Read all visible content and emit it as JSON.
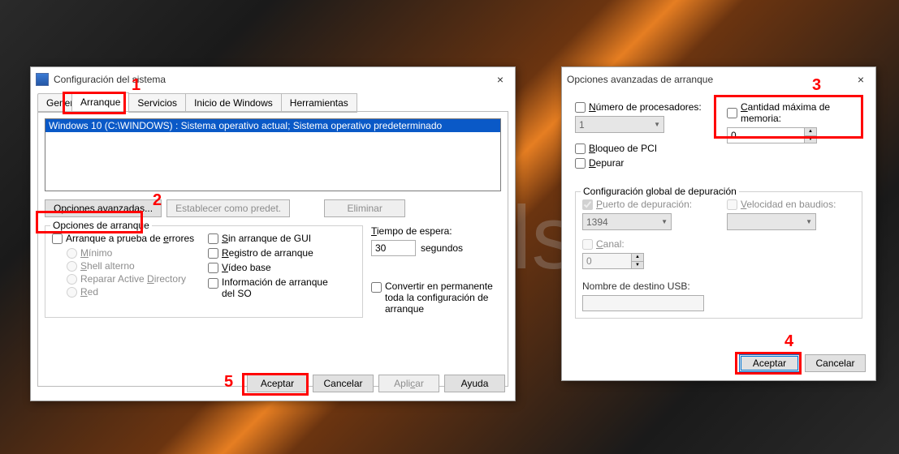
{
  "bg_text": "lso",
  "annotations": {
    "n1": "1",
    "n2": "2",
    "n3": "3",
    "n4": "4",
    "n5": "5"
  },
  "win1": {
    "title": "Configuración del sistema",
    "close": "×",
    "tabs": {
      "general": "General",
      "boot": "Arranque",
      "services": "Servicios",
      "startup": "Inicio de Windows",
      "tools": "Herramientas"
    },
    "boot_entry": "Windows 10 (C:\\WINDOWS) : Sistema operativo actual; Sistema operativo predeterminado",
    "buttons": {
      "advanced": "Opciones avanzadas...",
      "set_default": "Establecer como predet.",
      "delete": "Eliminar"
    },
    "group_boot": {
      "title": "Opciones de arranque",
      "safe": "Arranque a prueba de errores",
      "safe_u": "e",
      "min": "Mínimo",
      "min_u": "M",
      "altshell": "Shell alterno",
      "altshell_u": "S",
      "adrepair": "Reparar Active Directory",
      "adrepair_u": "D",
      "net": "Red",
      "net_u": "R",
      "nogui": "Sin arranque de GUI",
      "nogui_u": "S",
      "bootlog": "Registro de arranque",
      "bootlog_u": "R",
      "basevid": "Vídeo base",
      "basevid_u": "V",
      "osinfo": "Información de arranque del SO"
    },
    "timeout": {
      "label": "Tiempo de espera:",
      "label_u": "T",
      "value": "30",
      "unit": "segundos"
    },
    "permanent": "Convertir en permanente toda la configuración de arranque",
    "footer": {
      "ok": "Aceptar",
      "cancel": "Cancelar",
      "apply": "Aplicar",
      "help": "Ayuda"
    }
  },
  "win2": {
    "title": "Opciones avanzadas de arranque",
    "close": "×",
    "nproc": {
      "label": "Número de procesadores:",
      "label_u": "N",
      "value": "1"
    },
    "maxmem": {
      "label": "Cantidad máxima de memoria:",
      "label_u": "C",
      "value": "0"
    },
    "pcilock": {
      "label": "Bloqueo de PCI",
      "label_u": "B"
    },
    "debug": {
      "label": "Depurar",
      "label_u": "D"
    },
    "group_debug": {
      "title": "Configuración global de depuración",
      "port": {
        "label": "Puerto de depuración:",
        "label_u": "P",
        "value": "1394"
      },
      "baud": {
        "label": "Velocidad en baudios:",
        "label_u": "V",
        "value": ""
      },
      "channel": {
        "label": "Canal:",
        "label_u": "C",
        "value": "0"
      },
      "usb": {
        "label": "Nombre de destino USB:"
      }
    },
    "footer": {
      "ok": "Aceptar",
      "cancel": "Cancelar"
    }
  }
}
